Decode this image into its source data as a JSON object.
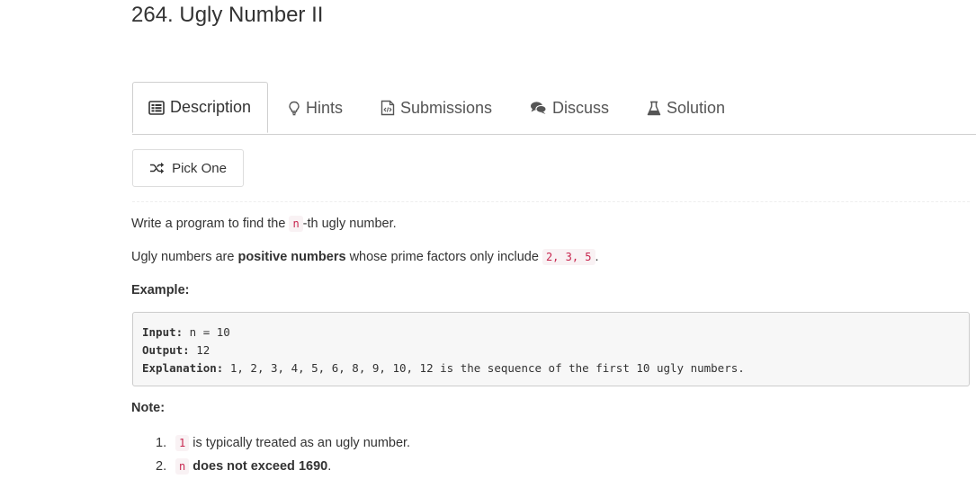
{
  "problem": {
    "title": "264. Ugly Number II"
  },
  "tabs": [
    {
      "label": "Description",
      "icon": "description-icon",
      "active": true
    },
    {
      "label": "Hints",
      "icon": "lightbulb-icon",
      "active": false
    },
    {
      "label": "Submissions",
      "icon": "code-file-icon",
      "active": false
    },
    {
      "label": "Discuss",
      "icon": "comments-icon",
      "active": false
    },
    {
      "label": "Solution",
      "icon": "flask-icon",
      "active": false
    }
  ],
  "pick_one": {
    "label": "Pick One",
    "icon": "shuffle-icon"
  },
  "content": {
    "line1_before": "Write a program to find the",
    "line1_code": "n",
    "line1_after": "-th ugly number.",
    "line2_before": "Ugly numbers are",
    "line2_bold": "positive numbers",
    "line2_mid": "whose prime factors only include",
    "line2_code": "2, 3, 5",
    "line2_after": ".",
    "example_heading": "Example:",
    "example": {
      "input_label": "Input:",
      "input_value": " n = 10",
      "output_label": "Output:",
      "output_value": " 12",
      "explanation_label": "Explanation:",
      "explanation_value": " 1, 2, 3, 4, 5, 6, 8, 9, 10, 12 is the sequence of the first 10 ugly numbers."
    },
    "note_heading": "Note:",
    "notes": [
      {
        "num": "1.",
        "code": "1",
        "text": "is typically treated as an ugly number."
      },
      {
        "num": "2.",
        "code": "n",
        "bold": "does not exceed 1690",
        "after": "."
      }
    ]
  },
  "colors": {
    "code_text": "#c7254e",
    "code_bg": "#f9f2f4",
    "tab_border": "#cfcfcf",
    "pre_bg": "#f7f7f7"
  }
}
